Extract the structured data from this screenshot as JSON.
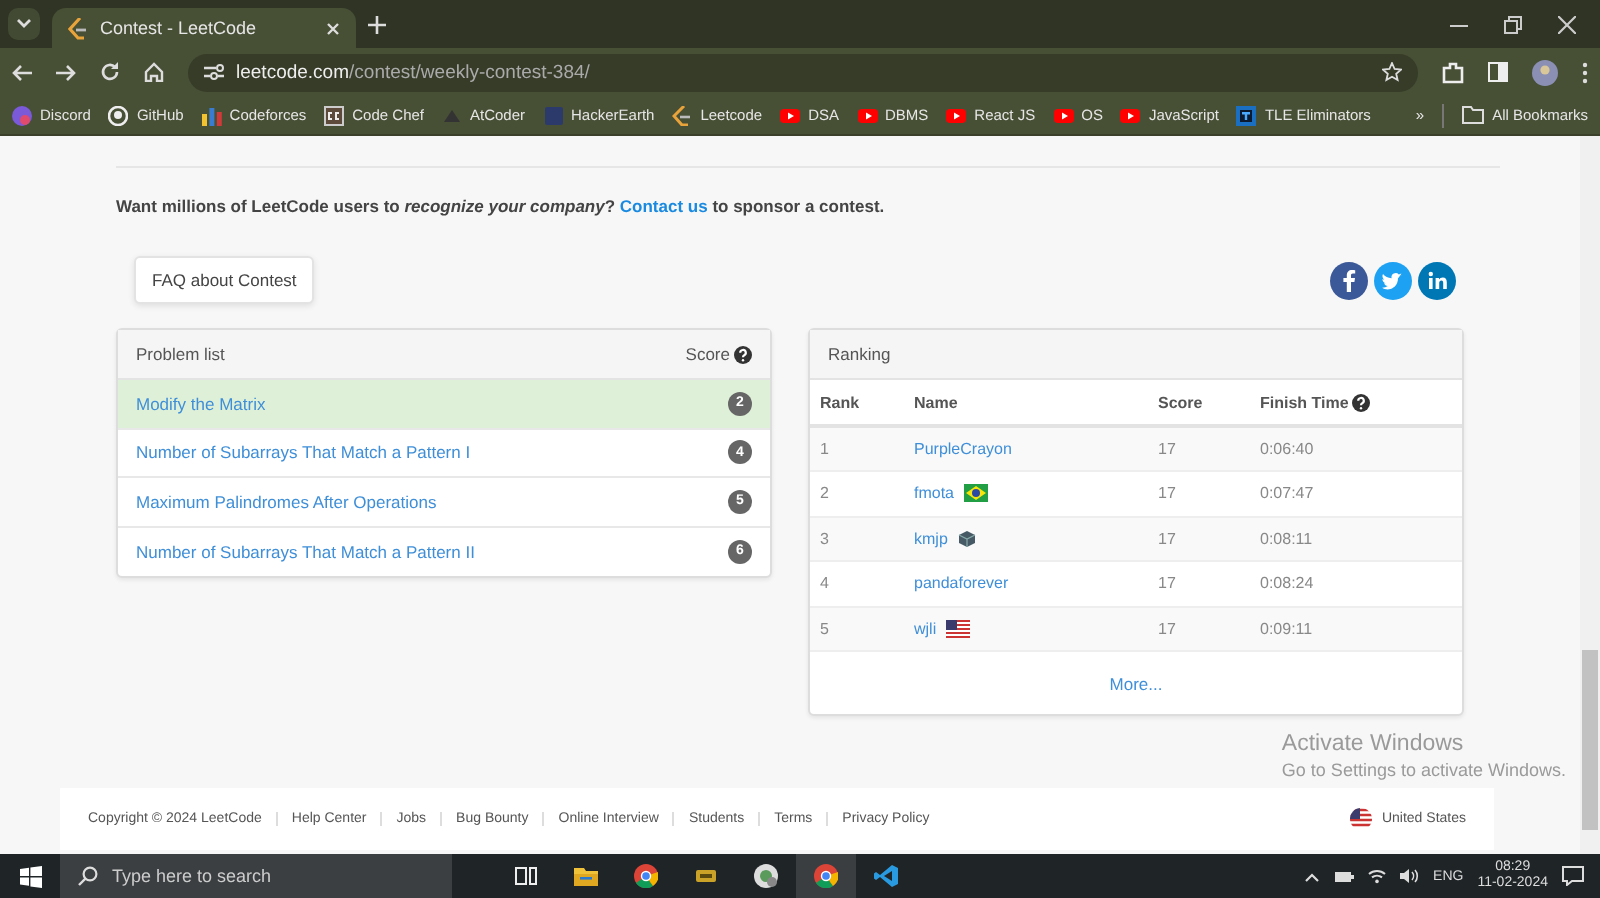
{
  "browser": {
    "tab_title": "Contest - LeetCode",
    "address_host": "leetcode.com",
    "address_path": "/contest/weekly-contest-384/",
    "bookmarks": [
      "Discord",
      "GitHub",
      "Codeforces",
      "Code Chef",
      "AtCoder",
      "HackerEarth",
      "Leetcode",
      "DSA",
      "DBMS",
      "React JS",
      "OS",
      "JavaScript",
      "TLE Eliminators"
    ],
    "more": "»",
    "all_bookmarks": "All Bookmarks"
  },
  "sponsor": {
    "text": "Want millions of LeetCode users to *recognize your company*?",
    "link": "Contact us",
    "tail": "to sponsor a contest."
  },
  "faq_button": "FAQ about Contest",
  "problems": {
    "title": "Problem list",
    "score_label": "Score",
    "rows": [
      {
        "title": "Modify the Matrix",
        "score": "2",
        "selected": true
      },
      {
        "title": "Number of Subarrays That Match a Pattern I",
        "score": "4",
        "selected": false
      },
      {
        "title": "Maximum Palindromes After Operations",
        "score": "5",
        "selected": false
      },
      {
        "title": "Number of Subarrays That Match a Pattern II",
        "score": "6",
        "selected": false
      }
    ]
  },
  "ranking": {
    "title": "Ranking",
    "columns": [
      "Rank",
      "Name",
      "Score",
      "Finish Time"
    ],
    "rows": [
      {
        "rank": "1",
        "name": "PurpleCrayon",
        "score": "17",
        "time": "0:06:40"
      },
      {
        "rank": "2",
        "name": "fmota",
        "score": "17",
        "time": "0:07:47"
      },
      {
        "rank": "3",
        "name": "kmjp",
        "score": "17",
        "time": "0:08:11"
      },
      {
        "rank": "4",
        "name": "pandaforever",
        "score": "17",
        "time": "0:08:24"
      },
      {
        "rank": "5",
        "name": "wjli",
        "score": "17",
        "time": "0:09:11"
      }
    ],
    "more": "More..."
  },
  "footer": {
    "copyright": "Copyright © 2024 LeetCode",
    "links": [
      "Help Center",
      "Jobs",
      "Bug Bounty",
      "Online Interview",
      "Students",
      "Terms",
      "Privacy Policy"
    ],
    "region": "United States"
  },
  "activation": {
    "title": "Activate Windows",
    "hint": "Go to Settings to activate Windows."
  },
  "taskbar": {
    "search_placeholder": "Type here to search",
    "language": "ENG",
    "time": "08:29",
    "date": "11-02-2024"
  }
}
